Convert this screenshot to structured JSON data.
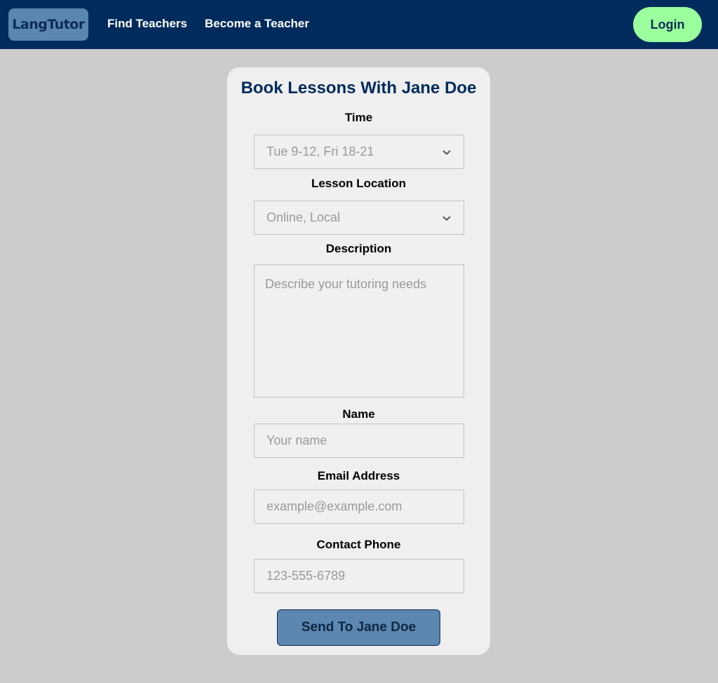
{
  "nav": {
    "logo": "LangTutor",
    "links": [
      "Find Teachers",
      "Become a Teacher"
    ],
    "login": "Login"
  },
  "form": {
    "title": "Book Lessons With Jane Doe",
    "time": {
      "label": "Time",
      "placeholder": "Tue 9-12, Fri 18-21"
    },
    "location": {
      "label": "Lesson Location",
      "placeholder": "Online, Local"
    },
    "description": {
      "label": "Description",
      "placeholder": "Describe your tutoring needs"
    },
    "name": {
      "label": "Name",
      "placeholder": "Your name"
    },
    "email": {
      "label": "Email Address",
      "placeholder": "example@example.com"
    },
    "phone": {
      "label": "Contact Phone",
      "placeholder": "123-555-6789"
    },
    "submit": "Send To Jane Doe"
  },
  "icons": {
    "select_chevron": "chevron-down-icon"
  },
  "colors": {
    "navbar": "#002b5c",
    "login": "#9bff9d",
    "logo_bg": "#5a87b0",
    "submit_bg": "#5b87b0",
    "page_bg": "#cccccc"
  }
}
